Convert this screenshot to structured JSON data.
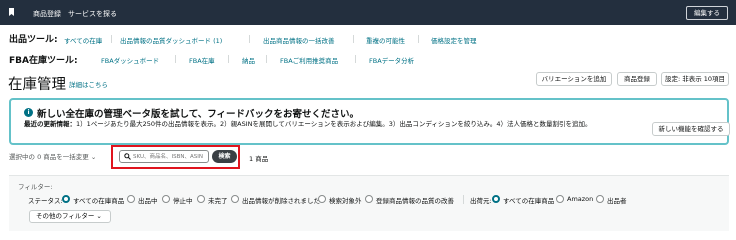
{
  "topbar": {
    "item1": "商品登録",
    "item2": "サービスを探る",
    "edit_label": "編集する"
  },
  "listing_tools": {
    "label": "出品ツール:",
    "links": [
      "すべての在庫",
      "出品情報の品質ダッシュボード (1)",
      "出品商品情報の一括改善",
      "重複の可能性",
      "価格設定を管理"
    ]
  },
  "fba_tools": {
    "label": "FBA在庫ツール:",
    "links": [
      "FBAダッシュボード",
      "FBA在庫",
      "納品",
      "FBAご利用推奨商品",
      "FBAデータ分析"
    ]
  },
  "header": {
    "title": "在庫管理",
    "help_link": "詳細はこちら",
    "buttons": [
      "バリエーションを追加",
      "商品登録",
      "設定: 非表示 10項目"
    ]
  },
  "banner": {
    "title": "新しい全在庫の管理ベータ版を試して、フィードバックをお寄せください。",
    "body_bold": "最近の更新情報：",
    "body_text": "1）1ページあたり最大250件の出品情報を表示。2）親ASINを展開してバリエーションを表示および編集。3）出品コンディションを絞り込み。4）法人価格と数量割引を追加。",
    "cta": "新しい機能を確認する"
  },
  "toolbar": {
    "bulk_select": "選択中の 0 商品を一括変更 ⌄",
    "search_placeholder": "SKU、商品名、ISBN、ASIN",
    "search_button": "検索",
    "count": "1 商品"
  },
  "filters": {
    "label": "フィルター:",
    "status_label": "ステータス:",
    "status_options": [
      {
        "label": "すべての在庫商品",
        "selected": true
      },
      {
        "label": "出品中",
        "selected": false
      },
      {
        "label": "停止中",
        "selected": false
      },
      {
        "label": "未完了",
        "selected": false
      },
      {
        "label": "出品情報が削除されました",
        "selected": false
      },
      {
        "label": "検索対象外",
        "selected": false
      },
      {
        "label": "登録商品情報の品質の改善",
        "selected": false
      }
    ],
    "channel_label": "出荷元:",
    "channel_options": [
      {
        "label": "すべての在庫商品",
        "selected": true
      },
      {
        "label": "Amazon",
        "selected": false
      },
      {
        "label": "出品者",
        "selected": false
      }
    ],
    "other_filters": "その他のフィルター ⌄"
  },
  "colors": {
    "topbar_bg": "#232f3e",
    "link": "#007185",
    "banner_border": "#64c2c9",
    "highlight_frame": "#e0141e",
    "search_button_bg": "#3a3f44"
  }
}
